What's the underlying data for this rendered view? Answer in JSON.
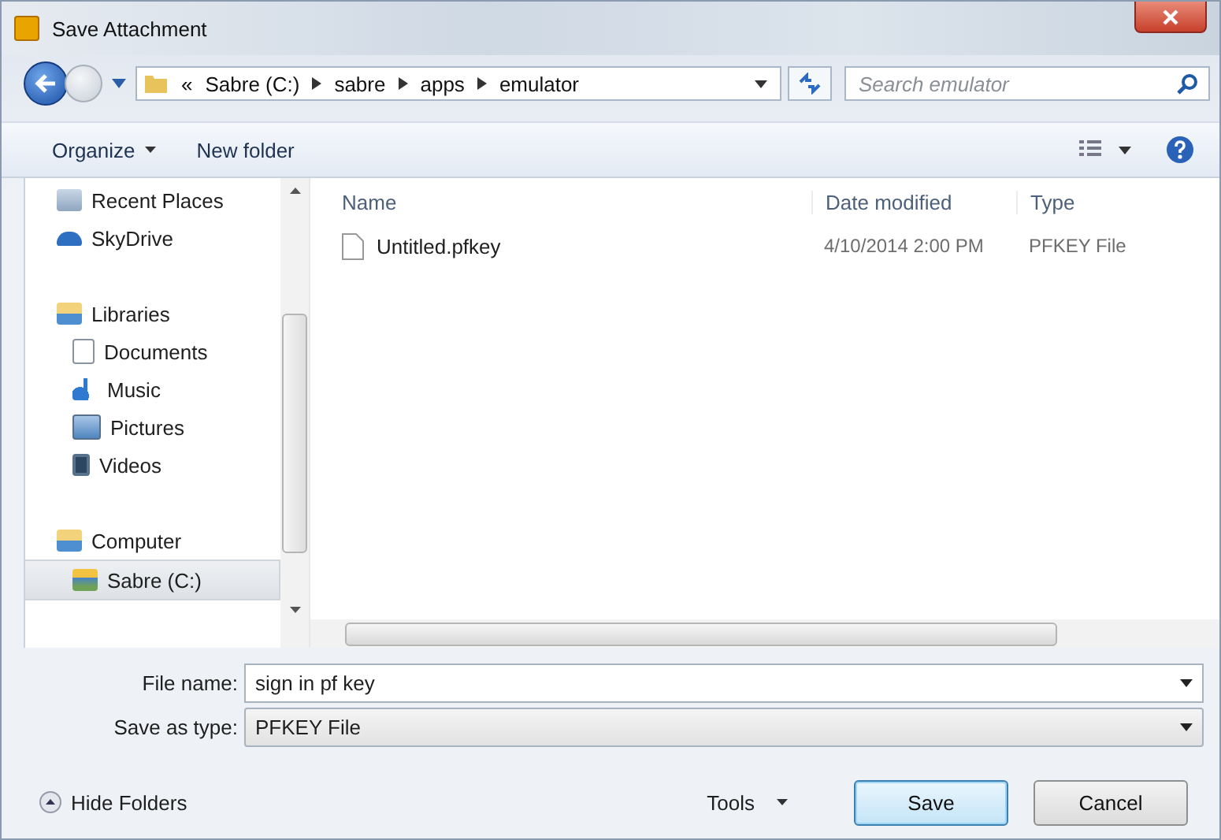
{
  "window": {
    "title": "Save Attachment"
  },
  "address": {
    "crumbs": [
      "«",
      "Sabre (C:)",
      "sabre",
      "apps",
      "emulator"
    ]
  },
  "search": {
    "placeholder": "Search emulator"
  },
  "toolbar": {
    "buttons": [
      {
        "label": "Organize",
        "dropdown": true
      },
      {
        "label": "New folder",
        "dropdown": false
      }
    ]
  },
  "sidebar": {
    "sections": [
      {
        "items": [
          {
            "label": "Recent Places",
            "kind": "recent",
            "selected": false
          },
          {
            "label": "SkyDrive",
            "kind": "cloud",
            "selected": false
          }
        ]
      },
      {
        "items": [
          {
            "label": "Libraries",
            "kind": "library",
            "selected": false,
            "children": [
              {
                "label": "Documents",
                "kind": "document",
                "selected": false
              },
              {
                "label": "Music",
                "kind": "music",
                "selected": false
              },
              {
                "label": "Pictures",
                "kind": "pictures",
                "selected": false
              },
              {
                "label": "Videos",
                "kind": "videos",
                "selected": false
              }
            ]
          }
        ]
      },
      {
        "items": [
          {
            "label": "Computer",
            "kind": "library",
            "selected": false,
            "children": [
              {
                "label": "Sabre (C:)",
                "kind": "drive",
                "selected": true
              }
            ]
          }
        ]
      }
    ]
  },
  "table": {
    "columns": [
      "Name",
      "Date modified",
      "Type"
    ],
    "rows": [
      {
        "cells": [
          "Untitled.pfkey",
          "4/10/2014 2:00 PM",
          "PFKEY File"
        ],
        "selected": false
      }
    ]
  },
  "form": {
    "fields": [
      {
        "label": "File name:",
        "value": "sign in pf key",
        "kind": "combo"
      },
      {
        "label": "Save as type:",
        "value": "PFKEY File",
        "kind": "select"
      }
    ]
  },
  "footer": {
    "toggle": "Hide Folders",
    "tools": "Tools",
    "buttons": [
      {
        "label": "Save",
        "default": true
      },
      {
        "label": "Cancel",
        "default": false
      }
    ]
  }
}
